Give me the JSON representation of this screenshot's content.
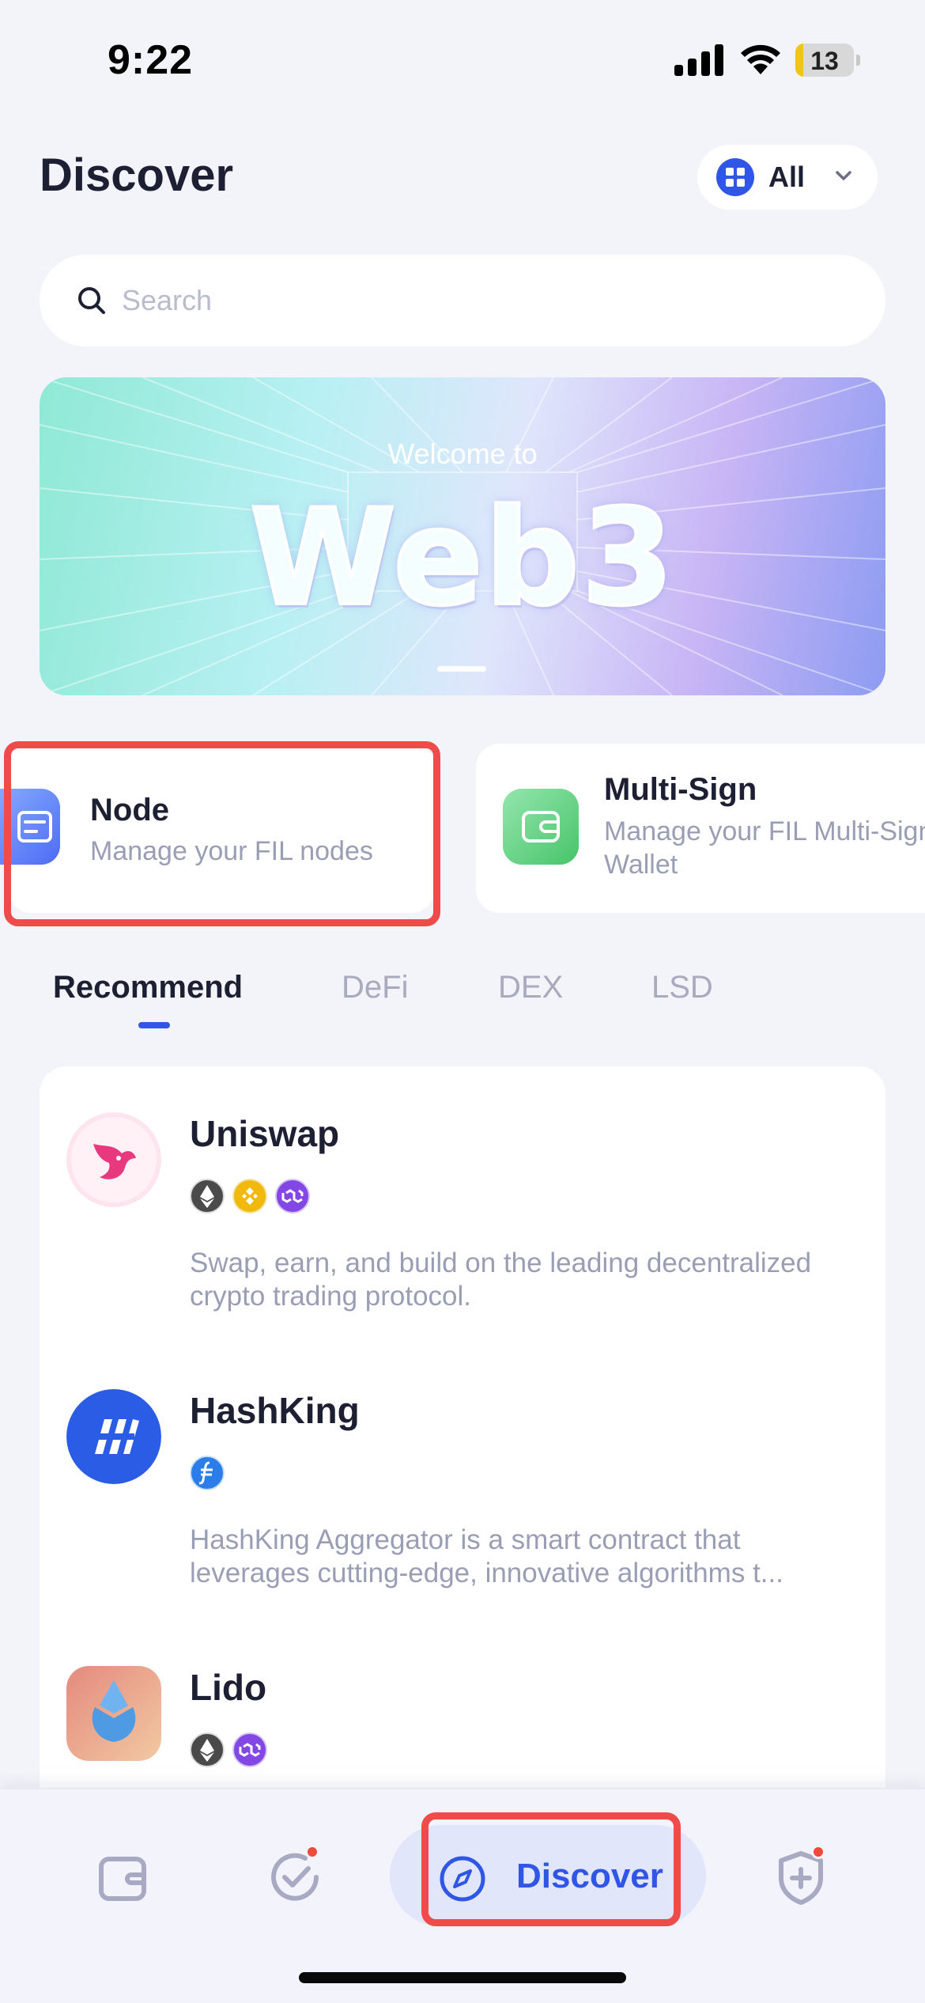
{
  "status_bar": {
    "time": "9:22",
    "battery": "13",
    "battery_level": 0.13
  },
  "header": {
    "title": "Discover",
    "chain_filter_label": "All"
  },
  "search": {
    "placeholder": "Search",
    "value": ""
  },
  "banner": {
    "subtitle": "Welcome to",
    "title": "Web3"
  },
  "feature_cards": [
    {
      "title": "Node",
      "description": "Manage your FIL nodes",
      "icon": "node-card-icon"
    },
    {
      "title": "Multi-Sign",
      "description": "Manage your FIL Multi-Sign Wallet",
      "icon": "wallet-icon"
    }
  ],
  "tabs": [
    {
      "label": "Recommend",
      "active": true
    },
    {
      "label": "DeFi",
      "active": false
    },
    {
      "label": "DEX",
      "active": false
    },
    {
      "label": "LSD",
      "active": false
    }
  ],
  "dapps": [
    {
      "name": "Uniswap",
      "description": "Swap, earn, and build on the leading decentralized crypto trading protocol.",
      "chains": [
        "ethereum",
        "bnb",
        "polygon"
      ]
    },
    {
      "name": "HashKing",
      "description": "HashKing Aggregator is a smart contract that leverages cutting-edge, innovative algorithms t...",
      "chains": [
        "fvm"
      ]
    },
    {
      "name": "Lido",
      "description": "",
      "chains": [
        "ethereum",
        "polygon"
      ]
    }
  ],
  "bottom_nav": {
    "items": [
      {
        "name": "wallet",
        "icon": "wallet-icon",
        "badge": false
      },
      {
        "name": "tasks",
        "icon": "check-circle-icon",
        "badge": true
      },
      {
        "name": "discover",
        "label": "Discover",
        "icon": "compass-icon",
        "active": true
      },
      {
        "name": "security",
        "icon": "shield-plus-icon",
        "badge": true
      }
    ]
  },
  "colors": {
    "accent": "#2f56e6",
    "highlight_box": "#f04b4b",
    "background": "#f3f4f9"
  }
}
